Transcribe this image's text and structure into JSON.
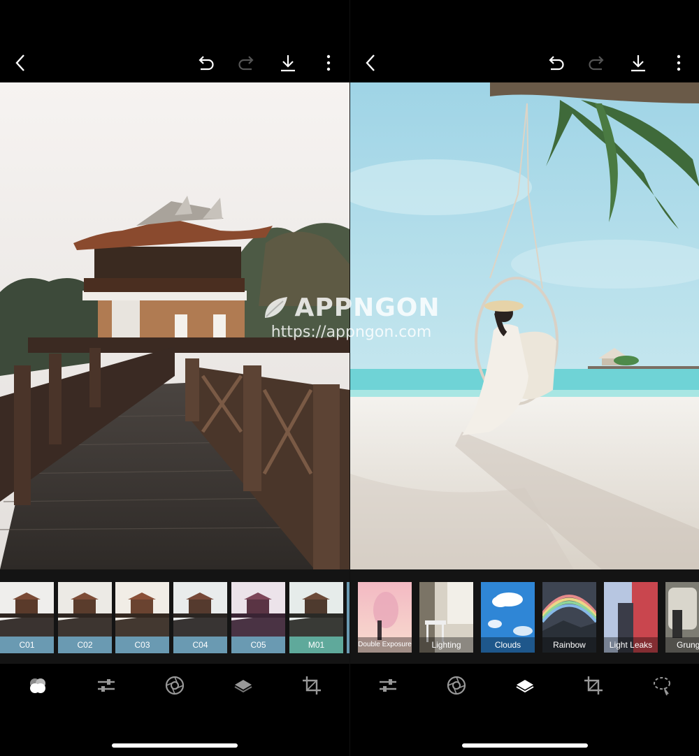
{
  "watermark": {
    "brand": "APPNGON",
    "url": "https://appngon.com"
  },
  "left_screen": {
    "toolbar": [
      "back-icon",
      "undo-icon",
      "redo-icon",
      "download-icon",
      "more-icon"
    ],
    "filters": [
      {
        "label": "C01",
        "color": "#6a9ab2"
      },
      {
        "label": "C02",
        "color": "#6a9ab2"
      },
      {
        "label": "C03",
        "color": "#6a9ab2"
      },
      {
        "label": "C04",
        "color": "#6a9ab2"
      },
      {
        "label": "C05",
        "color": "#6a9ab2"
      },
      {
        "label": "M01",
        "color": "#5fa99b"
      }
    ],
    "bottom_tools": [
      "filters-icon",
      "adjust-icon",
      "lens-icon",
      "layers-icon",
      "crop-icon"
    ],
    "active_tool": "filters-icon"
  },
  "right_screen": {
    "toolbar": [
      "back-icon",
      "undo-icon",
      "redo-icon",
      "download-icon",
      "more-icon"
    ],
    "effects": [
      {
        "label": "Double Exposure"
      },
      {
        "label": "Lighting"
      },
      {
        "label": "Clouds"
      },
      {
        "label": "Rainbow"
      },
      {
        "label": "Light Leaks"
      },
      {
        "label": "Grung"
      }
    ],
    "bottom_tools": [
      "adjust-icon",
      "lens-icon",
      "layers-icon",
      "crop-icon",
      "lasso-icon"
    ],
    "active_tool": "layers-icon"
  }
}
